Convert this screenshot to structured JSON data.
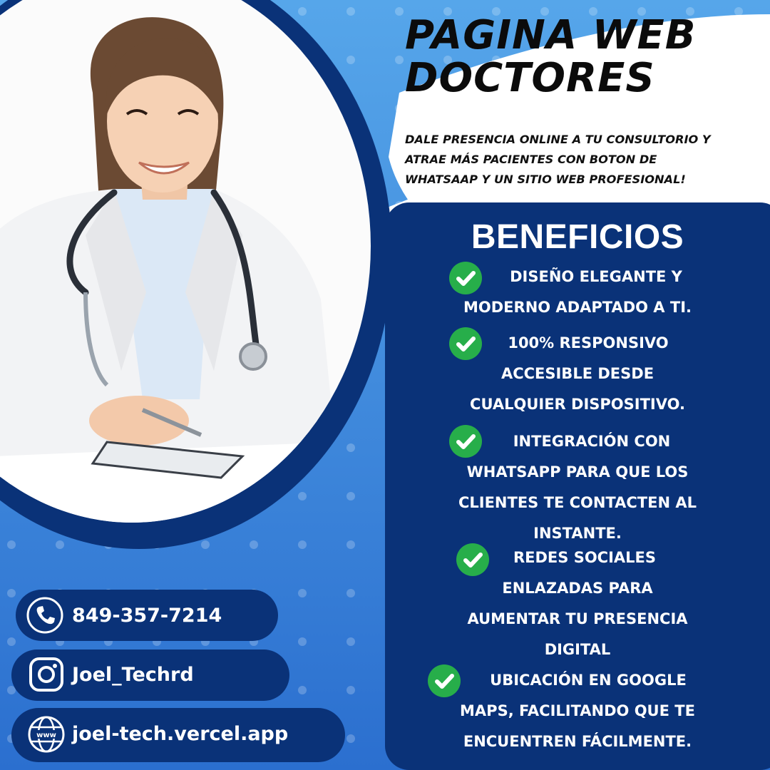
{
  "header": {
    "title_line1": "PAGINA WEB",
    "title_line2": "DOCTORES",
    "subtitle_line1": "DALE PRESENCIA ONLINE A TU CONSULTORIO Y",
    "subtitle_line2": "ATRAE MÁS PACIENTES CON BOTON DE",
    "subtitle_line3": "WHATSAAP Y UN SITIO WEB PROFESIONAL!"
  },
  "benefits": {
    "title": "BENEFICIOS",
    "items": [
      {
        "lines": [
          "DISEÑO ELEGANTE Y",
          "MODERNO ADAPTADO A TI."
        ]
      },
      {
        "lines": [
          "100% RESPONSIVO",
          "ACCESIBLE DESDE",
          "CUALQUIER DISPOSITIVO."
        ]
      },
      {
        "lines": [
          "INTEGRACIÓN CON",
          "WHATSAPP PARA QUE LOS",
          "CLIENTES TE CONTACTEN AL",
          "INSTANTE."
        ]
      },
      {
        "lines": [
          "REDES SOCIALES",
          "ENLAZADAS PARA",
          "AUMENTAR TU PRESENCIA",
          "DIGITAL"
        ]
      },
      {
        "lines": [
          "UBICACIÓN EN GOOGLE",
          "MAPS, FACILITANDO QUE TE",
          "ENCUENTREN FÁCILMENTE."
        ]
      }
    ]
  },
  "contacts": {
    "phone": {
      "icon": "phone-icon",
      "text": "849-357-7214"
    },
    "instagram": {
      "icon": "instagram-icon",
      "text": "Joel_Techrd"
    },
    "website": {
      "icon": "globe-www-icon",
      "text": "joel-tech.vercel.app"
    }
  },
  "colors": {
    "navy": "#0a3278",
    "blue_light": "#4f9de6",
    "blue_mid": "#2f76d2",
    "check_green": "#27ae4a",
    "white": "#ffffff"
  }
}
